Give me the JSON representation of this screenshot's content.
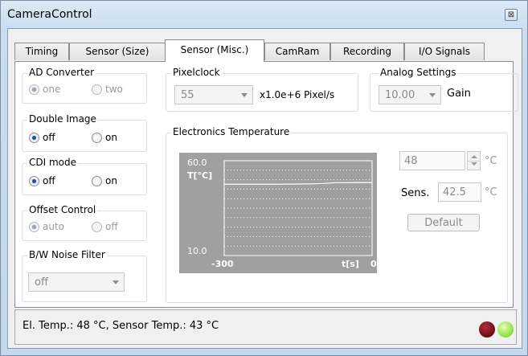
{
  "window": {
    "title": "CameraControl",
    "close_glyph": "⊠"
  },
  "tabs": [
    {
      "label": "Timing",
      "active": false
    },
    {
      "label": "Sensor (Size)",
      "active": false
    },
    {
      "label": "Sensor (Misc.)",
      "active": true
    },
    {
      "label": "CamRam",
      "active": false
    },
    {
      "label": "Recording",
      "active": false
    },
    {
      "label": "I/O Signals",
      "active": false
    }
  ],
  "ad_converter": {
    "label": "AD Converter",
    "options": [
      "one",
      "two"
    ],
    "selected": "one",
    "enabled": false
  },
  "double_image": {
    "label": "Double Image",
    "options": [
      "off",
      "on"
    ],
    "selected": "off",
    "enabled": true
  },
  "cdi_mode": {
    "label": "CDI mode",
    "options": [
      "off",
      "on"
    ],
    "selected": "off",
    "enabled": true
  },
  "offset_control": {
    "label": "Offset Control",
    "options": [
      "auto",
      "off"
    ],
    "selected": "auto",
    "enabled": false
  },
  "bw_noise_filter": {
    "label": "B/W Noise Filter",
    "value": "off"
  },
  "pixelclock": {
    "label": "Pixelclock",
    "value": "55",
    "unit": "x1.0e+6 Pixel/s"
  },
  "analog_settings": {
    "label": "Analog Settings",
    "value": "10.00",
    "unit": "Gain"
  },
  "electronics_temperature": {
    "label": "Electronics Temperature",
    "setpoint": "48",
    "setpoint_unit": "°C",
    "sens_label": "Sens.",
    "sens_value": "42.5",
    "sens_unit": "°C",
    "default_button": "Default"
  },
  "chart_data": {
    "type": "line",
    "title": "",
    "ylabel": "T[°C]",
    "xlabel": "t[s]",
    "ylim": [
      10,
      60
    ],
    "xlim": [
      -300,
      0
    ],
    "y_tick_labels": [
      "60.0",
      "10.0"
    ],
    "x_tick_labels": [
      "-300",
      "0"
    ],
    "grid": true,
    "series": [
      {
        "color": "#ffffff",
        "x": [
          -300,
          -250,
          -200,
          -150,
          -125,
          -100,
          -75,
          -50,
          -25,
          0
        ],
        "y": [
          47.6,
          47.6,
          47.6,
          47.7,
          47.8,
          48.0,
          48.4,
          48.4,
          48.5,
          48.5
        ]
      }
    ]
  },
  "status": {
    "text": "El. Temp.: 48 °C, Sensor Temp.: 43 °C",
    "led_colors": [
      "#7a0f1a",
      "#9ee84a"
    ]
  }
}
